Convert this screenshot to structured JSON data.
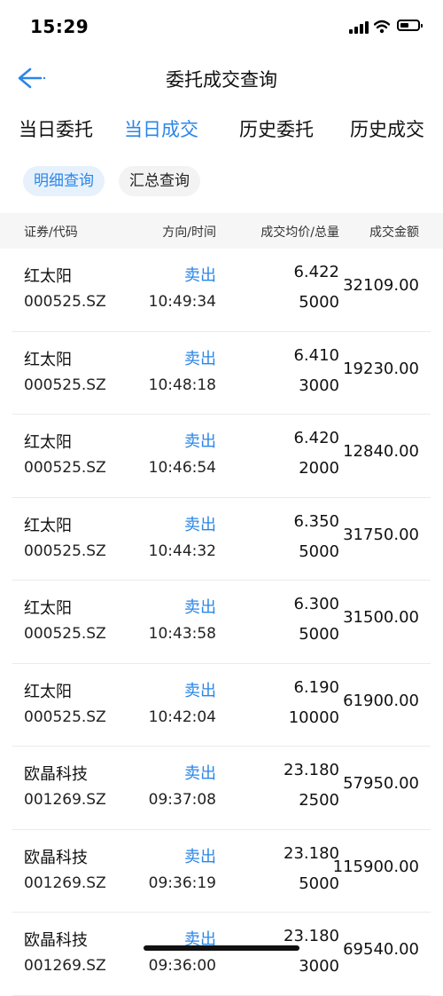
{
  "status_bar": {
    "time": "15:29"
  },
  "header": {
    "title": "委托成交查询"
  },
  "tabs": [
    {
      "label": "当日委托"
    },
    {
      "label": "当日成交"
    },
    {
      "label": "历史委托"
    },
    {
      "label": "历史成交"
    }
  ],
  "subtabs": [
    {
      "label": "明细查询"
    },
    {
      "label": "汇总查询"
    }
  ],
  "columns": {
    "security": "证券/代码",
    "direction": "方向/时间",
    "price_qty": "成交均价/总量",
    "amount": "成交金额"
  },
  "colors": {
    "accent": "#2b86e8",
    "header_bg": "#f6f6f6",
    "chip_bg": "#e7f1fc"
  },
  "trades": [
    {
      "name": "红太阳",
      "code": "000525.SZ",
      "direction": "卖出",
      "time": "10:49:34",
      "price": "6.422",
      "qty": "5000",
      "amount": "32109.00"
    },
    {
      "name": "红太阳",
      "code": "000525.SZ",
      "direction": "卖出",
      "time": "10:48:18",
      "price": "6.410",
      "qty": "3000",
      "amount": "19230.00"
    },
    {
      "name": "红太阳",
      "code": "000525.SZ",
      "direction": "卖出",
      "time": "10:46:54",
      "price": "6.420",
      "qty": "2000",
      "amount": "12840.00"
    },
    {
      "name": "红太阳",
      "code": "000525.SZ",
      "direction": "卖出",
      "time": "10:44:32",
      "price": "6.350",
      "qty": "5000",
      "amount": "31750.00"
    },
    {
      "name": "红太阳",
      "code": "000525.SZ",
      "direction": "卖出",
      "time": "10:43:58",
      "price": "6.300",
      "qty": "5000",
      "amount": "31500.00"
    },
    {
      "name": "红太阳",
      "code": "000525.SZ",
      "direction": "卖出",
      "time": "10:42:04",
      "price": "6.190",
      "qty": "10000",
      "amount": "61900.00"
    },
    {
      "name": "欧晶科技",
      "code": "001269.SZ",
      "direction": "卖出",
      "time": "09:37:08",
      "price": "23.180",
      "qty": "2500",
      "amount": "57950.00"
    },
    {
      "name": "欧晶科技",
      "code": "001269.SZ",
      "direction": "卖出",
      "time": "09:36:19",
      "price": "23.180",
      "qty": "5000",
      "amount": "115900.00"
    },
    {
      "name": "欧晶科技",
      "code": "001269.SZ",
      "direction": "卖出",
      "time": "09:36:00",
      "price": "23.180",
      "qty": "3000",
      "amount": "69540.00"
    }
  ]
}
